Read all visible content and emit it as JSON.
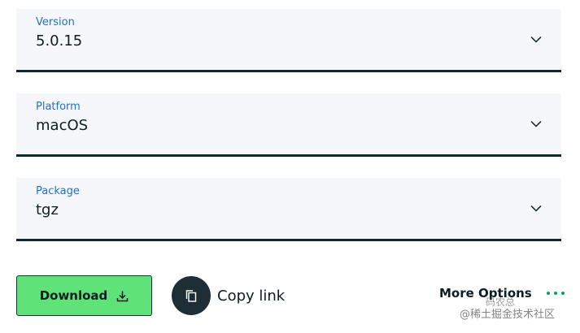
{
  "fields": [
    {
      "label": "Version",
      "value": "5.0.15"
    },
    {
      "label": "Platform",
      "value": "macOS"
    },
    {
      "label": "Package",
      "value": "tgz"
    }
  ],
  "actions": {
    "download_label": "Download",
    "copy_link_label": "Copy link",
    "more_options_label": "More Options"
  },
  "watermark": {
    "line1": "码农总",
    "line2": "@稀土掘金技术社区"
  },
  "colors": {
    "label": "#1f6fd6",
    "underline": "#0b2a2e",
    "field_bg": "#f5f7fa",
    "download_bg": "#5fe378",
    "copy_circle": "#1f2e36",
    "dots": "#00a35c"
  },
  "icons": {
    "chevron": "chevron-down-icon",
    "download": "download-icon",
    "copy": "copy-icon",
    "more": "more-dots-icon"
  }
}
